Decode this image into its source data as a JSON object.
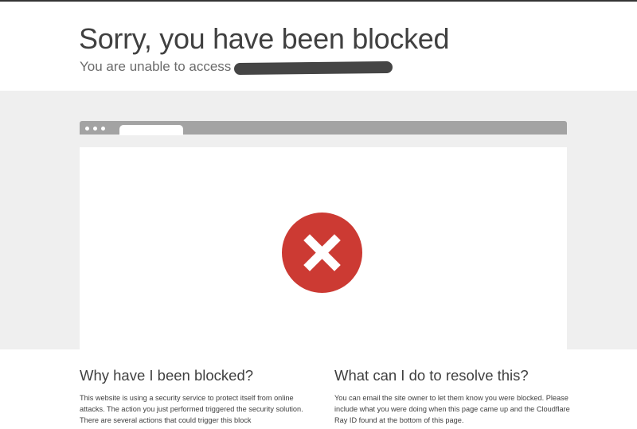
{
  "header": {
    "title": "Sorry, you have been blocked",
    "subtitle": "You are unable to access"
  },
  "error_icon": "close-icon",
  "colors": {
    "error_red": "#cc3a33",
    "browser_bar": "#a3a3a3",
    "band_background": "#efefef",
    "text": "#404040"
  },
  "sections": {
    "why": {
      "title": "Why have I been blocked?",
      "body": "This website is using a security service to protect itself from online attacks. The action you just performed triggered the security solution. There are several actions that could trigger this block"
    },
    "resolve": {
      "title": "What can I do to resolve this?",
      "body": "You can email the site owner to let them know you were blocked. Please include what you were doing when this page came up and the Cloudflare Ray ID found at the bottom of this page."
    }
  }
}
